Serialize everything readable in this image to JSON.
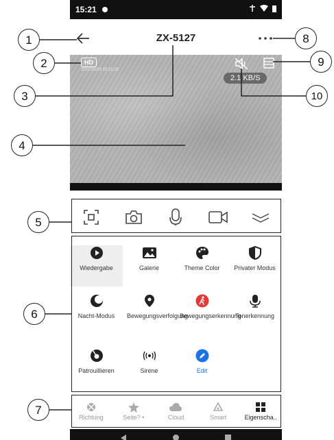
{
  "status_bar": {
    "time": "15:21"
  },
  "app_bar": {
    "title": "ZX-5127",
    "back_icon": "arrow-left-icon",
    "more_icon": "more-dots-icon"
  },
  "video": {
    "quality_badge": "HD",
    "timestamp": "2021/01/03 15:21:25",
    "speed": "2.1 KB/S"
  },
  "toolbar": [
    "screenshot-icon",
    "camera-icon",
    "microphone-icon",
    "video-record-icon",
    "collapse-chevron-icon"
  ],
  "features": [
    {
      "label": "Wiedergabe",
      "icon": "play-circle-icon",
      "selected": true
    },
    {
      "label": "Galerie",
      "icon": "gallery-icon"
    },
    {
      "label": "Theme Color",
      "icon": "palette-icon"
    },
    {
      "label": "Privater Modus",
      "icon": "shield-half-icon"
    },
    {
      "label": "Nacht-Modus",
      "icon": "moon-icon"
    },
    {
      "label": "Bewegungsverfolgung",
      "icon": "location-pin-icon"
    },
    {
      "label": "Bewegungserkennung",
      "icon": "walking-person-icon"
    },
    {
      "label": "Tonerkennung",
      "icon": "microphone-filled-icon"
    },
    {
      "label": "Patrouillieren",
      "icon": "patrol-icon"
    },
    {
      "label": "Sirene",
      "icon": "siren-waves-icon"
    },
    {
      "label": "Edit",
      "icon": "edit-pencil-icon"
    }
  ],
  "bottom_nav": [
    {
      "label": "Richtung",
      "icon": "direction-icon"
    },
    {
      "label": "Seite? •",
      "icon": "star-icon"
    },
    {
      "label": "Cloud",
      "icon": "cloud-icon"
    },
    {
      "label": "Smart",
      "icon": "smart-icon"
    },
    {
      "label": "Eigenscha..",
      "icon": "grid-icon",
      "active": true
    }
  ],
  "callouts": [
    "1",
    "2",
    "3",
    "4",
    "5",
    "6",
    "7",
    "8",
    "9",
    "10"
  ],
  "colors": {
    "edit_blue": "#1a73e8",
    "siren_red": "#e53935",
    "status_bar": "#111111"
  }
}
